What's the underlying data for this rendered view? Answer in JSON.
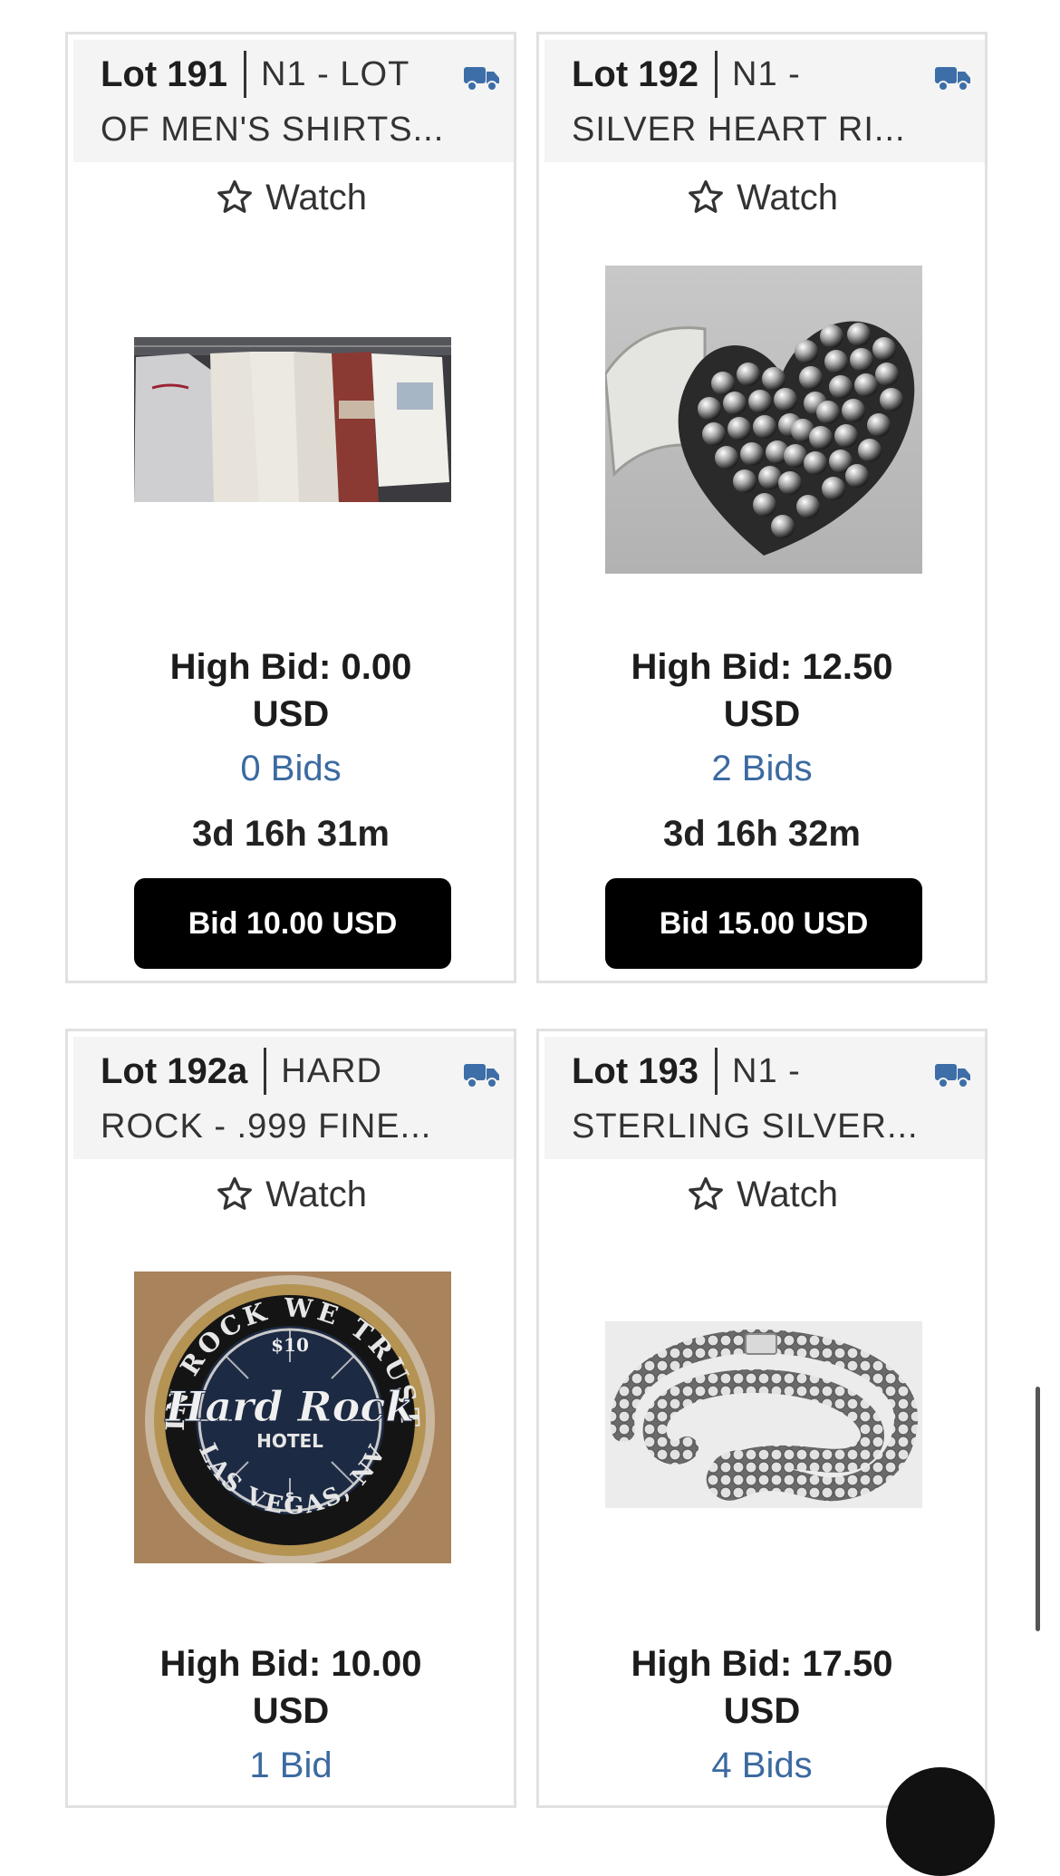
{
  "lots": [
    {
      "lot_label": "Lot 191",
      "title_line1": "N1 - LOT",
      "title_line2": "OF MEN'S SHIRTS...",
      "watch_label": "Watch",
      "high_bid_line1": "High Bid: 0.00",
      "high_bid_line2": "USD",
      "bids": "0 Bids",
      "time_left": "3d 16h 31m",
      "bid_button": "Bid 10.00 USD",
      "shipping_icon": "truck-icon"
    },
    {
      "lot_label": "Lot 192",
      "title_line1": "N1 -",
      "title_line2": "SILVER HEART RI...",
      "watch_label": "Watch",
      "high_bid_line1": "High Bid: 12.50",
      "high_bid_line2": "USD",
      "bids": "2 Bids",
      "time_left": "3d 16h 32m",
      "bid_button": "Bid 15.00 USD",
      "shipping_icon": "truck-icon"
    },
    {
      "lot_label": "Lot 192a",
      "title_line1": "HARD",
      "title_line2": "ROCK - .999 FINE...",
      "watch_label": "Watch",
      "high_bid_line1": "High Bid: 10.00",
      "high_bid_line2": "USD",
      "bids": "1 Bid",
      "shipping_icon": "truck-icon",
      "image_text": {
        "top_arc": "IN ROCK WE TRUST",
        "denomination": "$10",
        "brand": "Hard Rock",
        "sub": "HOTEL",
        "bottom_arc": "LAS VEGAS, NV",
        "mark": "S"
      }
    },
    {
      "lot_label": "Lot 193",
      "title_line1": "N1 -",
      "title_line2": "STERLING SILVER...",
      "watch_label": "Watch",
      "high_bid_line1": "High Bid: 17.50",
      "high_bid_line2": "USD",
      "bids": "4 Bids",
      "shipping_icon": "truck-icon"
    }
  ],
  "colors": {
    "bid_count": "#3b6aa0",
    "truck_icon": "#3d6ea8",
    "bid_button_bg": "#000000",
    "header_bg": "#f4f4f4"
  }
}
